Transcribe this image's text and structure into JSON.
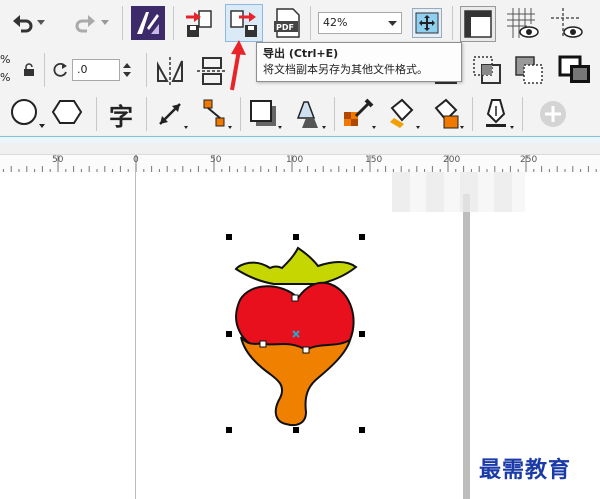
{
  "toolbar": {
    "zoom_value": "42%",
    "pdf_label": "PDF"
  },
  "property_bar": {
    "left_labels": [
      "%",
      "%"
    ],
    "outline_value": ".0"
  },
  "toolbox": {
    "text_tool_glyph": "字"
  },
  "tooltip": {
    "title": "导出 (Ctrl+E)",
    "description": "将文档副本另存为其他文件格式。"
  },
  "ruler": {
    "labels": [
      "50",
      "0",
      "50",
      "100",
      "150",
      "200",
      "250"
    ]
  },
  "colors": {
    "leaf_green": "#c6d600",
    "berry_red": "#e8101c",
    "chocolate_orange": "#f08000",
    "arrow_red": "#e8232a",
    "watermark_blue": "#1a3aa8"
  },
  "watermark": "最需教育"
}
